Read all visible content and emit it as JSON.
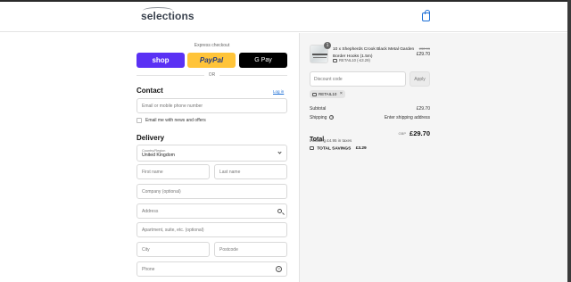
{
  "header": {
    "logo_text": "selections",
    "bag_icon": "shopping-bag-icon"
  },
  "express": {
    "title": "Express checkout",
    "shop_label": "shop",
    "paypal_label": "PayPal",
    "gpay_label": "G Pay",
    "or_label": "OR"
  },
  "contact": {
    "heading": "Contact",
    "login_label": "Log in",
    "email_placeholder": "Email or mobile phone number",
    "news_label": "Email me with news and offers"
  },
  "delivery": {
    "heading": "Delivery",
    "country_label": "Country/Region",
    "country_value": "United Kingdom",
    "first_name_placeholder": "First name",
    "last_name_placeholder": "Last name",
    "company_placeholder": "Company (optional)",
    "address_placeholder": "Address",
    "apartment_placeholder": "Apartment, suite, etc. (optional)",
    "city_placeholder": "City",
    "postcode_placeholder": "Postcode",
    "phone_placeholder": "Phone"
  },
  "summary": {
    "product": {
      "quantity": "1",
      "name": "10 x Shepherds Crook Black Metal Garden Border Hooks (1.5m)",
      "discount": "RETAIL10 (-£3.29)",
      "old_price": "£32.99",
      "price": "£29.70"
    },
    "discount_placeholder": "Discount code",
    "apply_label": "Apply",
    "applied_code": "RETAIL10",
    "subtotal_label": "Subtotal",
    "subtotal_value": "£29.70",
    "shipping_label": "Shipping",
    "shipping_value": "Enter shipping address",
    "total_label": "Total",
    "currency": "GBP",
    "total_value": "£29.70",
    "taxes_note": "Including £4.95 in taxes",
    "savings_label": "TOTAL SAVINGS",
    "savings_value": "£3.29"
  },
  "colors": {
    "shop_purple": "#5a31f4",
    "paypal_yellow": "#ffc439",
    "link_blue": "#1d6fd6"
  }
}
